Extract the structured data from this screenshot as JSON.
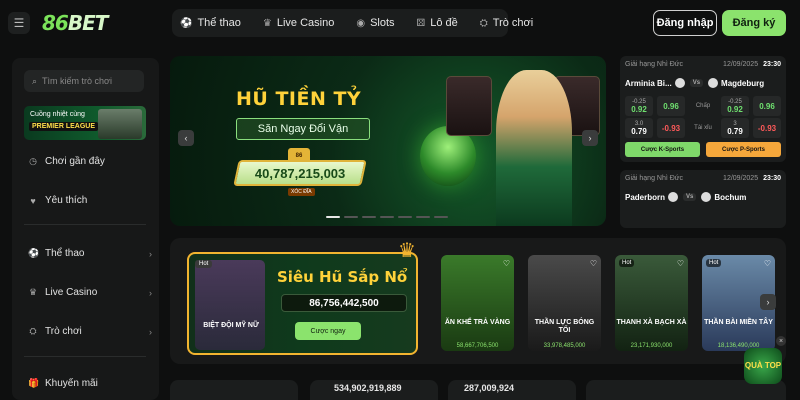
{
  "header": {
    "logo": {
      "main": "86",
      "accent": "BET"
    },
    "nav": [
      {
        "icon": "⚽",
        "label": "Thể thao"
      },
      {
        "icon": "♛",
        "label": "Live Casino"
      },
      {
        "icon": "◉",
        "label": "Slots"
      },
      {
        "icon": "⚄",
        "label": "Lô đề"
      },
      {
        "icon": "⛭",
        "label": "Trò chơi"
      }
    ],
    "login_label": "Đăng nhập",
    "register_label": "Đăng ký"
  },
  "sidebar": {
    "search_placeholder": "Tìm kiếm trò chơi",
    "promo": {
      "line1": "Cuồng nhiệt cùng",
      "line2": "PREMIER LEAGUE"
    },
    "items": [
      {
        "icon": "◷",
        "label": "Chơi gần đây"
      },
      {
        "icon": "♥",
        "label": "Yêu thích"
      },
      {
        "icon": "⚽",
        "label": "Thể thao"
      },
      {
        "icon": "♛",
        "label": "Live Casino"
      },
      {
        "icon": "⛭",
        "label": "Trò chơi"
      },
      {
        "icon": "🎁",
        "label": "Khuyến mãi"
      }
    ]
  },
  "hero": {
    "title": "HŨ TIỀN TỶ",
    "subtitle": "Săn Ngay Đổi Vận",
    "jackpot_value": "40,787,215,003",
    "jackpot_caption": "XÓC ĐĨA",
    "slides_total": 7,
    "slide_active": 1
  },
  "matches": [
    {
      "league": "Giải hạng Nhì Đức",
      "date": "12/09/2025",
      "time": "23:30",
      "home": "Arminia Bi...",
      "away": "Magdeburg",
      "handicap_label": "Chấp",
      "total_label": "Tài xỉu",
      "hc_home_line": "-0.25",
      "hc_home_odd": "0.92",
      "hc_mid_odd": "0.96",
      "hc_away_line": "-0.25",
      "hc_away_odd": "0.92",
      "hc_away_mid": "0.96",
      "tot_home_line": "3.0",
      "tot_home_odd": "0.79",
      "tot_mid_odd": "-0.93",
      "tot_away_line": "3",
      "tot_away_odd": "0.79",
      "tot_away_mid": "-0.93",
      "btn_k": "Cược K-Sports",
      "btn_p": "Cược P-Sports"
    },
    {
      "league": "Giải hạng Nhì Đức",
      "date": "12/09/2025",
      "time": "23:30",
      "home": "Paderborn",
      "away": "Bochum"
    }
  ],
  "feature_game": {
    "hot": "Hot",
    "art_label": "BIỆT ĐỘI MỸ NỮ",
    "title": "Siêu Hũ Sắp Nổ",
    "amount": "86,756,442,500",
    "button": "Cược ngay"
  },
  "games": [
    {
      "name": "ĂN KHẾ TRẢ VÀNG",
      "amount": "58,667,706,500",
      "hot": "",
      "color_top": "#3a7a2a",
      "color_bottom": "#1a3a12"
    },
    {
      "name": "THẦN LỰC BÓNG TỐI",
      "amount": "33,978,485,000",
      "hot": "",
      "color_top": "#4a4a4a",
      "color_bottom": "#1a1a1a"
    },
    {
      "name": "THANH XÀ BẠCH XÀ",
      "amount": "23,171,930,000",
      "hot": "Hot",
      "color_top": "#3a5a3a",
      "color_bottom": "#122212"
    },
    {
      "name": "THẦN BÀI MIỀN TÂY",
      "amount": "18,136,490,000",
      "hot": "Hot",
      "color_top": "#6a8aa8",
      "color_bottom": "#2a3a5a"
    }
  ],
  "bottom": {
    "amount_1": "534,902,919,889",
    "amount_2": "287,009,924"
  },
  "floating": {
    "label": "QUÀ TOP",
    "close": "×"
  }
}
